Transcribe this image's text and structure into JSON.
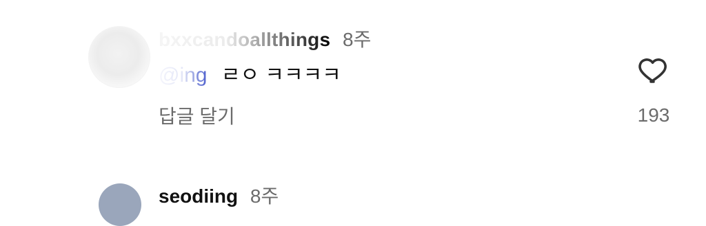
{
  "comments": [
    {
      "username": "bxxcandoallthings",
      "time": "8주",
      "mention": "@ing",
      "text": "ㄹㅇ ㅋㅋㅋㅋ",
      "reply_label": "답글 달기",
      "like_count": "193"
    },
    {
      "username": "seodiing",
      "time": "8주"
    }
  ],
  "icons": {
    "like": "heart-outline-icon"
  },
  "colors": {
    "mention": "#3c50c8",
    "secondary_text": "#6b6b6b",
    "primary_text": "#111111"
  }
}
